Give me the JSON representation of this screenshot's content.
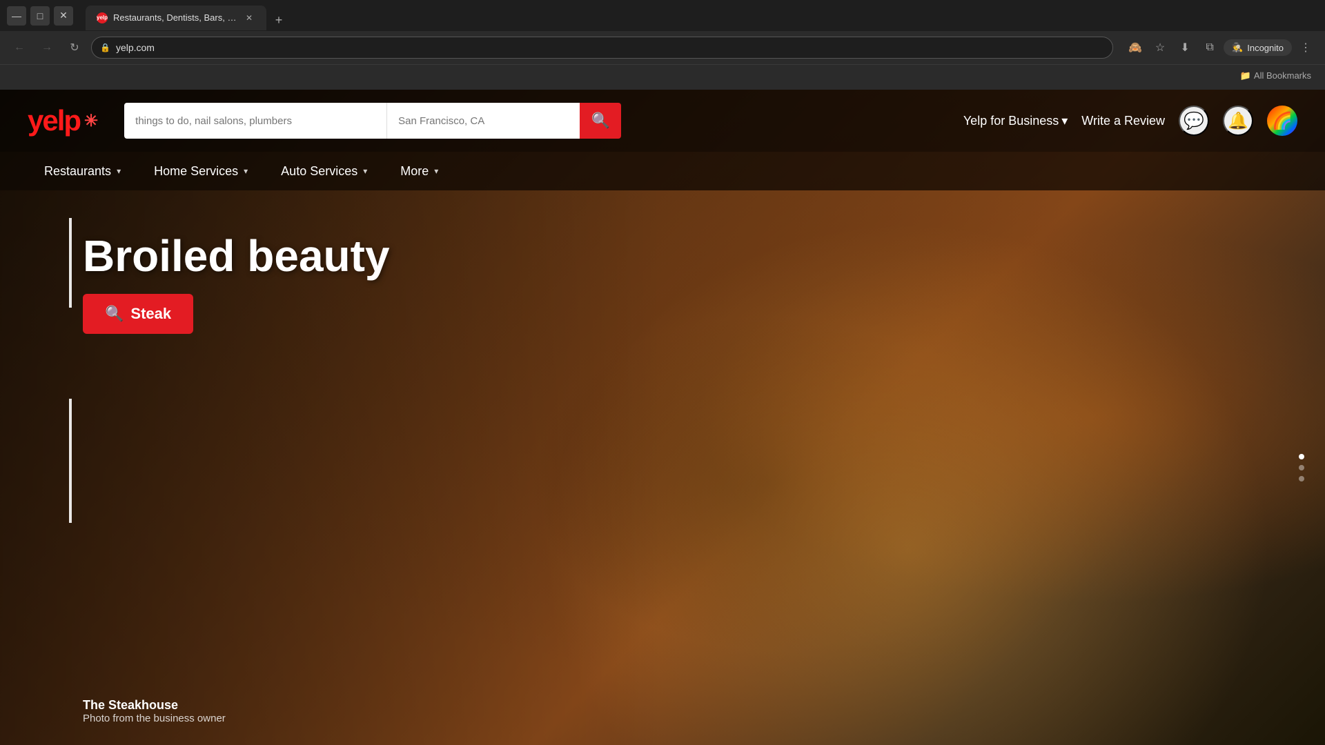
{
  "browser": {
    "tabs": [
      {
        "id": "tab-1",
        "label": "Restaurants, Dentists, Bars, Bea...",
        "favicon": "Y",
        "active": true
      }
    ],
    "address_bar": {
      "url": "yelp.com",
      "lock_icon": "🔒"
    },
    "new_tab_label": "+",
    "incognito_label": "Incognito",
    "bookmarks_label": "All Bookmarks"
  },
  "nav_buttons": {
    "back": "←",
    "forward": "→",
    "refresh": "↻",
    "minimize": "—",
    "maximize": "□",
    "close": "✕"
  },
  "toolbar_icons": {
    "eye_slash": "👁",
    "star": "☆",
    "download": "⬇",
    "window": "⧉",
    "person": "👤"
  },
  "yelp": {
    "logo_text": "yelp",
    "logo_burst": "✳",
    "search": {
      "placeholder": "things to do, nail salons, plumbers",
      "location_placeholder": "San Francisco, CA",
      "button_icon": "🔍"
    },
    "header_links": [
      {
        "id": "yelp-for-business",
        "label": "Yelp for Business",
        "has_chevron": true
      },
      {
        "id": "write-review",
        "label": "Write a Review"
      }
    ],
    "header_icons": [
      {
        "id": "messages",
        "icon": "💬"
      },
      {
        "id": "notifications",
        "icon": "🔔"
      },
      {
        "id": "avatar",
        "icon": "🌈"
      }
    ],
    "nav_items": [
      {
        "id": "restaurants",
        "label": "Restaurants",
        "has_chevron": true
      },
      {
        "id": "home-services",
        "label": "Home Services",
        "has_chevron": true
      },
      {
        "id": "auto-services",
        "label": "Auto Services",
        "has_chevron": true
      },
      {
        "id": "more",
        "label": "More",
        "has_chevron": true
      }
    ],
    "hero": {
      "title": "Broiled beauty",
      "cta_label": "Steak",
      "cta_icon": "🔍",
      "caption_title": "The Steakhouse",
      "caption_subtitle": "Photo from the business owner"
    }
  }
}
